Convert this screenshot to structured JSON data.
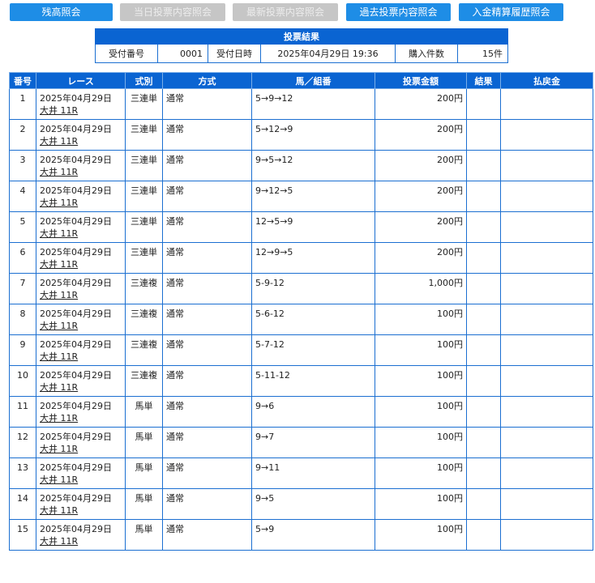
{
  "nav": {
    "buttons": [
      {
        "label": "残高照会",
        "enabled": true
      },
      {
        "label": "当日投票内容照会",
        "enabled": false
      },
      {
        "label": "最新投票内容照会",
        "enabled": false
      },
      {
        "label": "過去投票内容照会",
        "enabled": true
      },
      {
        "label": "入金精算履歴照会",
        "enabled": true
      }
    ]
  },
  "summary": {
    "title": "投票結果",
    "receipt_no_label": "受付番号",
    "receipt_no": "0001",
    "datetime_label": "受付日時",
    "datetime": "2025年04月29日 19:36",
    "count_label": "購入件数",
    "count": "15件"
  },
  "table": {
    "headers": [
      "番号",
      "レース",
      "式別",
      "方式",
      "馬／組番",
      "投票金額",
      "結果",
      "払戻金"
    ],
    "rows": [
      {
        "no": "1",
        "date": "2025年04月29日",
        "race": "大井 11R",
        "type": "三連単",
        "method": "通常",
        "combo": "5→9→12",
        "amount": "200円",
        "result": "",
        "payout": ""
      },
      {
        "no": "2",
        "date": "2025年04月29日",
        "race": "大井 11R",
        "type": "三連単",
        "method": "通常",
        "combo": "5→12→9",
        "amount": "200円",
        "result": "",
        "payout": ""
      },
      {
        "no": "3",
        "date": "2025年04月29日",
        "race": "大井 11R",
        "type": "三連単",
        "method": "通常",
        "combo": "9→5→12",
        "amount": "200円",
        "result": "",
        "payout": ""
      },
      {
        "no": "4",
        "date": "2025年04月29日",
        "race": "大井 11R",
        "type": "三連単",
        "method": "通常",
        "combo": "9→12→5",
        "amount": "200円",
        "result": "",
        "payout": ""
      },
      {
        "no": "5",
        "date": "2025年04月29日",
        "race": "大井 11R",
        "type": "三連単",
        "method": "通常",
        "combo": "12→5→9",
        "amount": "200円",
        "result": "",
        "payout": ""
      },
      {
        "no": "6",
        "date": "2025年04月29日",
        "race": "大井 11R",
        "type": "三連単",
        "method": "通常",
        "combo": "12→9→5",
        "amount": "200円",
        "result": "",
        "payout": ""
      },
      {
        "no": "7",
        "date": "2025年04月29日",
        "race": "大井 11R",
        "type": "三連複",
        "method": "通常",
        "combo": "5-9-12",
        "amount": "1,000円",
        "result": "",
        "payout": ""
      },
      {
        "no": "8",
        "date": "2025年04月29日",
        "race": "大井 11R",
        "type": "三連複",
        "method": "通常",
        "combo": "5-6-12",
        "amount": "100円",
        "result": "",
        "payout": ""
      },
      {
        "no": "9",
        "date": "2025年04月29日",
        "race": "大井 11R",
        "type": "三連複",
        "method": "通常",
        "combo": "5-7-12",
        "amount": "100円",
        "result": "",
        "payout": ""
      },
      {
        "no": "10",
        "date": "2025年04月29日",
        "race": "大井 11R",
        "type": "三連複",
        "method": "通常",
        "combo": "5-11-12",
        "amount": "100円",
        "result": "",
        "payout": ""
      },
      {
        "no": "11",
        "date": "2025年04月29日",
        "race": "大井 11R",
        "type": "馬単",
        "method": "通常",
        "combo": "9→6",
        "amount": "100円",
        "result": "",
        "payout": ""
      },
      {
        "no": "12",
        "date": "2025年04月29日",
        "race": "大井 11R",
        "type": "馬単",
        "method": "通常",
        "combo": "9→7",
        "amount": "100円",
        "result": "",
        "payout": ""
      },
      {
        "no": "13",
        "date": "2025年04月29日",
        "race": "大井 11R",
        "type": "馬単",
        "method": "通常",
        "combo": "9→11",
        "amount": "100円",
        "result": "",
        "payout": ""
      },
      {
        "no": "14",
        "date": "2025年04月29日",
        "race": "大井 11R",
        "type": "馬単",
        "method": "通常",
        "combo": "9→5",
        "amount": "100円",
        "result": "",
        "payout": ""
      },
      {
        "no": "15",
        "date": "2025年04月29日",
        "race": "大井 11R",
        "type": "馬単",
        "method": "通常",
        "combo": "5→9",
        "amount": "100円",
        "result": "",
        "payout": ""
      }
    ]
  },
  "colors": {
    "header_bg": "#0a64d2",
    "button_active": "#1e8de6",
    "button_disabled": "#c6c6c6",
    "border": "#1b6fd1"
  }
}
